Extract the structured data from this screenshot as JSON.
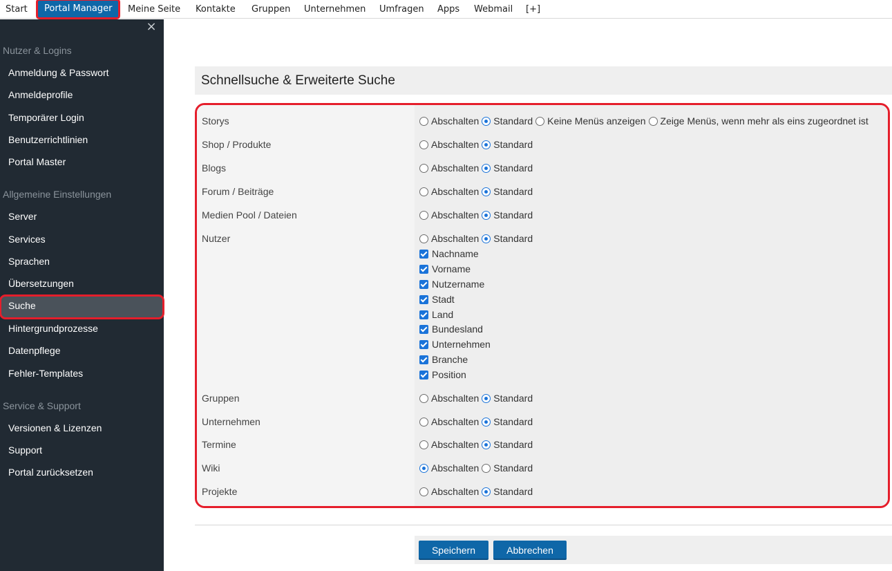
{
  "topnav": {
    "items": [
      "Start",
      "Portal Manager",
      "Meine Seite",
      "Kontakte",
      "Gruppen",
      "Unternehmen",
      "Umfragen",
      "Apps",
      "Webmail",
      "[+]"
    ],
    "active": "Portal Manager"
  },
  "sidebar": {
    "close_glyph": "×",
    "sections": [
      {
        "heading": "Nutzer & Logins",
        "items": [
          "Anmeldung & Passwort",
          "Anmeldeprofile",
          "Temporärer Login",
          "Benutzerrichtlinien",
          "Portal Master"
        ]
      },
      {
        "heading": "Allgemeine Einstellungen",
        "items": [
          "Server",
          "Services",
          "Sprachen",
          "Übersetzungen",
          "Suche",
          "Hintergrundprozesse",
          "Datenpflege",
          "Fehler-Templates"
        ]
      },
      {
        "heading": "Service & Support",
        "items": [
          "Versionen & Lizenzen",
          "Support",
          "Portal zurücksetzen"
        ]
      }
    ],
    "active_item": "Suche"
  },
  "main": {
    "title": "Schnellsuche & Erweiterte Suche",
    "option_labels": {
      "off": "Abschalten",
      "standard": "Standard",
      "no_menus": "Keine Menüs anzeigen",
      "show_menus": "Zeige Menüs, wenn mehr als eins zugeordnet ist"
    },
    "rows": [
      {
        "label": "Storys",
        "selected": "standard"
      },
      {
        "label": "Shop / Produkte",
        "selected": "standard"
      },
      {
        "label": "Blogs",
        "selected": "standard"
      },
      {
        "label": "Forum / Beiträge",
        "selected": "standard"
      },
      {
        "label": "Medien Pool / Dateien",
        "selected": "standard"
      },
      {
        "label": "Nutzer",
        "selected": "standard"
      },
      {
        "label": "Gruppen",
        "selected": "standard"
      },
      {
        "label": "Unternehmen",
        "selected": "standard"
      },
      {
        "label": "Termine",
        "selected": "standard"
      },
      {
        "label": "Wiki",
        "selected": "off"
      },
      {
        "label": "Projekte",
        "selected": "standard"
      }
    ],
    "user_fields": [
      "Nachname",
      "Vorname",
      "Nutzername",
      "Stadt",
      "Land",
      "Bundesland",
      "Unternehmen",
      "Branche",
      "Position"
    ],
    "buttons": {
      "save": "Speichern",
      "cancel": "Abbrechen"
    }
  },
  "colors": {
    "accent": "#0f67a8",
    "sidebar_bg": "#212a33",
    "highlight": "#e51e2b",
    "radio_checked": "#1a73d9"
  }
}
